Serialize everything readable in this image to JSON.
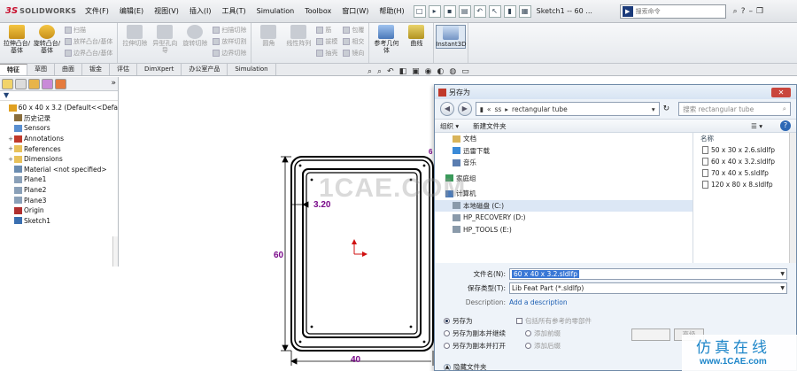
{
  "app": {
    "logo_prefix": "3S",
    "logo_text": "SOLIDWORKS",
    "doc_title": "Sketch1 -- 60 ...",
    "search_placeholder": "搜索命令"
  },
  "menu": [
    "文件(F)",
    "编辑(E)",
    "视图(V)",
    "插入(I)",
    "工具(T)",
    "Simulation",
    "Toolbox",
    "窗口(W)",
    "帮助(H)"
  ],
  "ribbon": {
    "extrude_boss": "拉伸凸台/基体",
    "revolve_boss": "旋转凸台/基体",
    "small_left": [
      "扫描",
      "放样凸台/基体",
      "边界凸台/基体"
    ],
    "extrude_cut": "拉伸切除",
    "hole_wizard": "异型孔向导",
    "revolve_cut": "旋转切除",
    "small_mid": [
      "扫描切除",
      "放样切割",
      "边界切除"
    ],
    "fillet": "圆角",
    "linear_pattern": "线性阵列",
    "small_right_1": [
      "筋",
      "拔模",
      "抽壳"
    ],
    "small_right_2": [
      "包覆",
      "相交",
      "镜向"
    ],
    "ref_geometry": "参考几何体",
    "curves": "曲线",
    "instant3d": "Instant3D"
  },
  "tabs": [
    "特征",
    "草图",
    "曲面",
    "钣金",
    "评估",
    "DimXpert",
    "办公室产品",
    "Simulation"
  ],
  "feature_tree": {
    "filter_icon": "funnel-icon",
    "items": [
      {
        "label": "60 x 40 x 3.2  (Default<<Defa",
        "icon": "part-icon",
        "expand": ""
      },
      {
        "label": "历史记录",
        "icon": "history-icon",
        "expand": ""
      },
      {
        "label": "Sensors",
        "icon": "sensor-icon",
        "expand": ""
      },
      {
        "label": "Annotations",
        "icon": "annotation-icon",
        "expand": "+"
      },
      {
        "label": "References",
        "icon": "folder-icon",
        "expand": "+"
      },
      {
        "label": "Dimensions",
        "icon": "folder-icon",
        "expand": "+"
      },
      {
        "label": "Material <not specified>",
        "icon": "material-icon",
        "expand": ""
      },
      {
        "label": "Plane1",
        "icon": "plane-icon",
        "expand": ""
      },
      {
        "label": "Plane2",
        "icon": "plane-icon",
        "expand": ""
      },
      {
        "label": "Plane3",
        "icon": "plane-icon",
        "expand": ""
      },
      {
        "label": "Origin",
        "icon": "origin-icon",
        "expand": ""
      },
      {
        "label": "Sketch1",
        "icon": "sketch-icon",
        "expand": ""
      }
    ]
  },
  "sketch": {
    "dim_thickness": "3.20",
    "dim_height": "60",
    "dim_width": "40",
    "dim_corner": "6"
  },
  "dialog": {
    "title": "另存为",
    "breadcrumb": [
      "ss",
      "rectangular tube"
    ],
    "search_placeholder": "搜索 rectangular tube",
    "organize": "组织 ▾",
    "new_folder": "新建文件夹",
    "nav_items": [
      {
        "label": "文档",
        "icon": "document-icon",
        "root": false
      },
      {
        "label": "迅雷下载",
        "icon": "download-icon",
        "root": false
      },
      {
        "label": "音乐",
        "icon": "music-icon",
        "root": false
      },
      {
        "label": "家庭组",
        "icon": "homegroup-icon",
        "root": true
      },
      {
        "label": "计算机",
        "icon": "computer-icon",
        "root": true
      },
      {
        "label": "本地磁盘 (C:)",
        "icon": "drive-icon",
        "root": false,
        "selected": true
      },
      {
        "label": "HP_RECOVERY (D:)",
        "icon": "drive-icon",
        "root": false
      },
      {
        "label": "HP_TOOLS (E:)",
        "icon": "drive-icon",
        "root": false
      }
    ],
    "column_name": "名称",
    "files": [
      "50 x 30 x 2.6.sldlfp",
      "60 x 40 x 3.2.sldlfp",
      "70 x 40 x 5.sldlfp",
      "120 x 80 x 8.sldlfp"
    ],
    "filename_label": "文件名(N):",
    "filename_value": "60 x 40 x 3.2.sldlfp",
    "savetype_label": "保存类型(T):",
    "savetype_value": "Lib Feat Part (*.sldlfp)",
    "description_label": "Description:",
    "description_link": "Add a description",
    "options": [
      "另存为",
      "另存为副本并继续",
      "另存为副本并打开"
    ],
    "include_refs": "包括所有参考的零部件",
    "add_prefix": "添加前缀",
    "add_suffix": "添加后缀",
    "advanced": "高级",
    "hide_folders": "隐藏文件夹"
  },
  "watermark": {
    "center": "1CAE.COM",
    "brand_cn": "仿真在线",
    "brand_url": "www.1CAE.com"
  },
  "colors": {
    "sketch_lines": "#000000",
    "dimension": "#7a0a8a",
    "selection": "#3a78d6",
    "origin": "#d01010"
  }
}
